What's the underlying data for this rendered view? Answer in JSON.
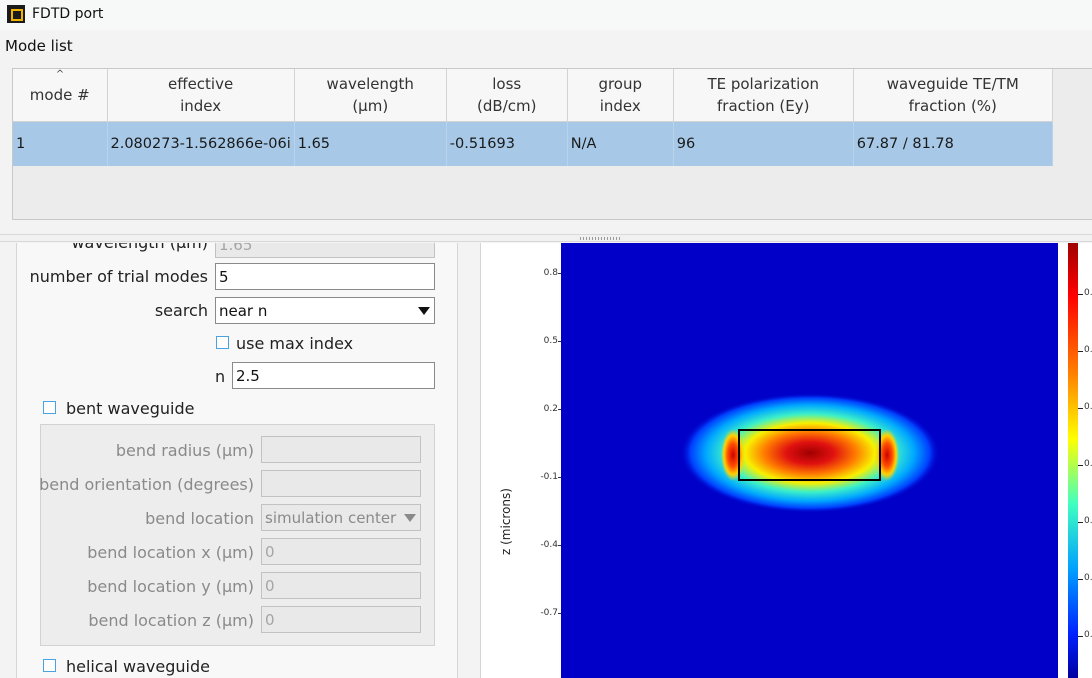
{
  "window": {
    "title": "FDTD port"
  },
  "mode_list": {
    "label": "Mode list",
    "columns": [
      {
        "line1": "mode #",
        "line2": ""
      },
      {
        "line1": "effective",
        "line2": "index"
      },
      {
        "line1": "wavelength",
        "line2": "(µm)"
      },
      {
        "line1": "loss",
        "line2": "(dB/cm)"
      },
      {
        "line1": "group",
        "line2": "index"
      },
      {
        "line1": "TE polarization",
        "line2": "fraction (Ey)"
      },
      {
        "line1": "waveguide TE/TM",
        "line2": "fraction (%)"
      }
    ],
    "rows": [
      [
        "1",
        "2.080273-1.562866e-06i",
        "1.65",
        "-0.51693",
        "N/A",
        "96",
        "67.87 / 81.78"
      ]
    ]
  },
  "settings": {
    "wavelength_label": "wavelength (µm)",
    "wavelength_value": "1.65",
    "trial_modes_label": "number of trial modes",
    "trial_modes_value": "5",
    "search_label": "search",
    "search_value": "near n",
    "use_max_index_label": "use max index",
    "n_label": "n",
    "n_value": "2.5",
    "bent_waveguide_label": "bent waveguide",
    "bend_radius_label": "bend radius (µm)",
    "bend_radius_value": "",
    "bend_orientation_label": "bend orientation (degrees)",
    "bend_orientation_value": "",
    "bend_location_label": "bend location",
    "bend_location_value": "simulation center",
    "bend_location_x_label": "bend location x (µm)",
    "bend_location_x_value": "0",
    "bend_location_y_label": "bend location y (µm)",
    "bend_location_y_value": "0",
    "bend_location_z_label": "bend location z (µm)",
    "bend_location_z_value": "0",
    "helical_waveguide_label": "helical waveguide"
  },
  "plot": {
    "ylabel": "z (microns)",
    "yticks": [
      "0.8",
      "0.5",
      "0.2",
      "-0.1",
      "-0.4",
      "-0.7"
    ],
    "colorbar_tick_labels": [
      "0.",
      "0.",
      "0.",
      "0.",
      "0.",
      "0.",
      "0."
    ]
  }
}
